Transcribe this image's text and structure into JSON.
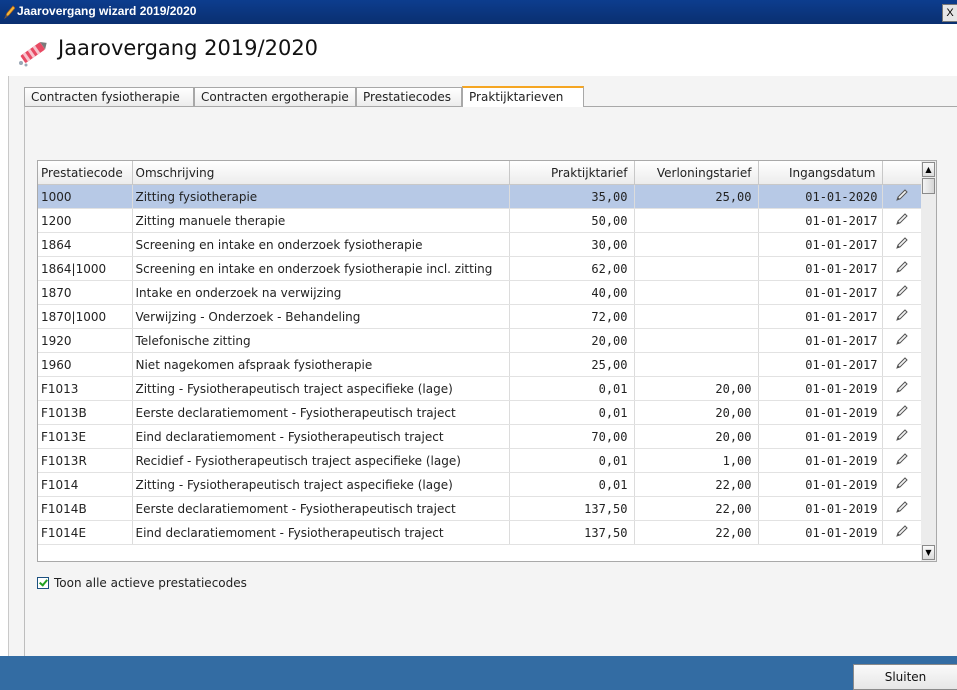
{
  "window": {
    "title": "Jaarovergang wizard 2019/2020",
    "close_glyph": "X"
  },
  "header": {
    "title": "Jaarovergang 2019/2020",
    "icon": "pencil-wand-icon"
  },
  "tabs": [
    {
      "label": "Contracten fysiotherapie",
      "active": false
    },
    {
      "label": "Contracten ergotherapie",
      "active": false
    },
    {
      "label": "Prestatiecodes",
      "active": false
    },
    {
      "label": "Praktijktarieven",
      "active": true
    }
  ],
  "table": {
    "columns": [
      "Prestatiecode",
      "Omschrijving",
      "Praktijktarief",
      "Verloningstarief",
      "Ingangsdatum"
    ],
    "rows": [
      {
        "code": "1000",
        "desc": "Zitting fysiotherapie",
        "praktijk": "35,00",
        "verloning": "25,00",
        "datum": "01-01-2020",
        "selected": true
      },
      {
        "code": "1200",
        "desc": "Zitting manuele therapie",
        "praktijk": "50,00",
        "verloning": "",
        "datum": "01-01-2017"
      },
      {
        "code": "1864",
        "desc": "Screening en intake en onderzoek fysiotherapie",
        "praktijk": "30,00",
        "verloning": "",
        "datum": "01-01-2017"
      },
      {
        "code": "1864|1000",
        "desc": "Screening en intake en onderzoek fysiotherapie incl. zitting",
        "praktijk": "62,00",
        "verloning": "",
        "datum": "01-01-2017"
      },
      {
        "code": "1870",
        "desc": "Intake en onderzoek na verwijzing",
        "praktijk": "40,00",
        "verloning": "",
        "datum": "01-01-2017"
      },
      {
        "code": "1870|1000",
        "desc": "Verwijzing - Onderzoek - Behandeling",
        "praktijk": "72,00",
        "verloning": "",
        "datum": "01-01-2017"
      },
      {
        "code": "1920",
        "desc": "Telefonische zitting",
        "praktijk": "20,00",
        "verloning": "",
        "datum": "01-01-2017"
      },
      {
        "code": "1960",
        "desc": "Niet nagekomen afspraak fysiotherapie",
        "praktijk": "25,00",
        "verloning": "",
        "datum": "01-01-2017"
      },
      {
        "code": "F1013",
        "desc": "Zitting - Fysiotherapeutisch traject aspecifieke (lage)",
        "praktijk": "0,01",
        "verloning": "20,00",
        "datum": "01-01-2019"
      },
      {
        "code": "F1013B",
        "desc": "Eerste declaratiemoment - Fysiotherapeutisch traject",
        "praktijk": "0,01",
        "verloning": "20,00",
        "datum": "01-01-2019"
      },
      {
        "code": "F1013E",
        "desc": "Eind declaratiemoment - Fysiotherapeutisch traject",
        "praktijk": "70,00",
        "verloning": "20,00",
        "datum": "01-01-2019"
      },
      {
        "code": "F1013R",
        "desc": "Recidief - Fysiotherapeutisch traject aspecifieke (lage)",
        "praktijk": "0,01",
        "verloning": "1,00",
        "datum": "01-01-2019"
      },
      {
        "code": "F1014",
        "desc": "Zitting - Fysiotherapeutisch traject aspecifieke (lage)",
        "praktijk": "0,01",
        "verloning": "22,00",
        "datum": "01-01-2019"
      },
      {
        "code": "F1014B",
        "desc": "Eerste declaratiemoment - Fysiotherapeutisch traject",
        "praktijk": "137,50",
        "verloning": "22,00",
        "datum": "01-01-2019"
      },
      {
        "code": "F1014E",
        "desc": "Eind declaratiemoment - Fysiotherapeutisch traject",
        "praktijk": "137,50",
        "verloning": "22,00",
        "datum": "01-01-2019"
      }
    ]
  },
  "checkbox": {
    "label": "Toon alle actieve prestatiecodes",
    "checked": true
  },
  "footer": {
    "close_label": "Sluiten"
  },
  "colors": {
    "titlebar": "#0c3d8e",
    "selection": "#b7c9e6",
    "footer": "#336ca3",
    "active_tab_accent": "#f5a623",
    "checkmark": "#21a121"
  }
}
